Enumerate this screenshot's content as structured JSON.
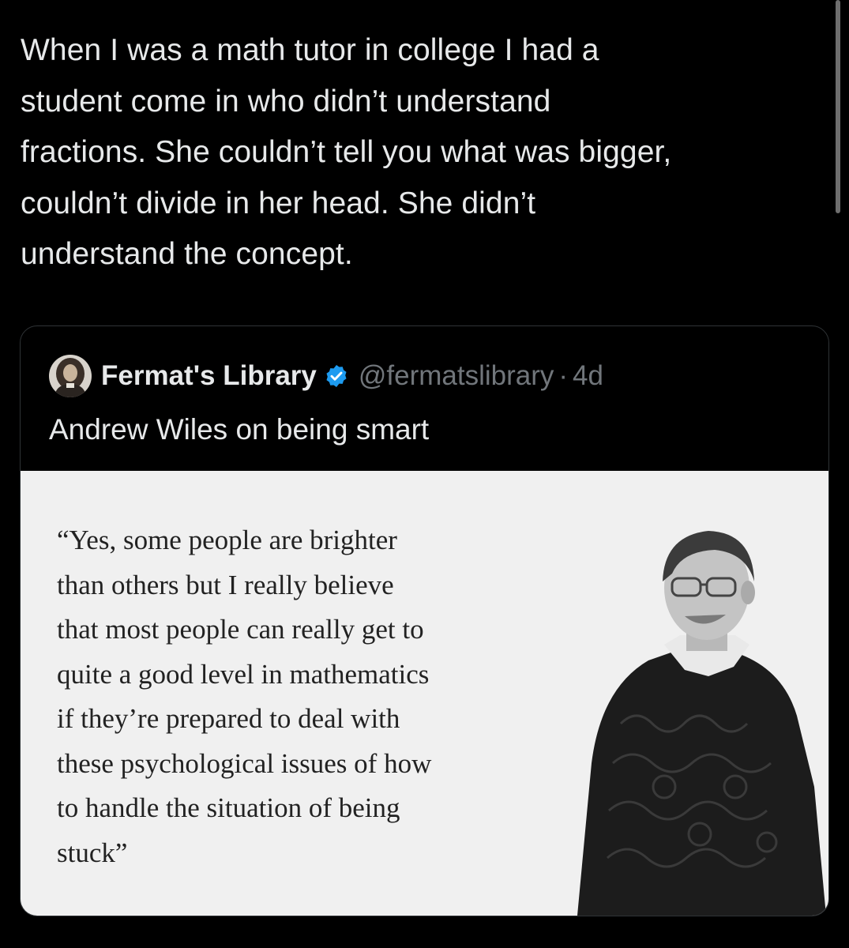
{
  "post": {
    "lines": [
      "When I was a math tutor in college I had a",
      "student come in who didn’t understand",
      "fractions. She couldn’t tell you what was bigger,",
      "couldn’t divide in her head. She didn’t",
      "understand the concept."
    ]
  },
  "quoted_post": {
    "display_name": "Fermat's Library",
    "handle": "@fermatslibrary",
    "separator": "·",
    "time": "4d",
    "text": "Andrew Wiles on being smart",
    "verified_icon": "verified-badge-icon",
    "verified_color": "#1d9bf0",
    "media": {
      "quote_lines": [
        "“Yes, some people are brighter",
        "than others but I really believe",
        "that most people can really get to",
        "quite a good level in mathematics",
        "if they’re prepared to deal with",
        "these psychological issues of how",
        "to handle the situation of being",
        "stuck”"
      ]
    }
  },
  "colors": {
    "background": "#000000",
    "text": "#e7e9ea",
    "secondary_text": "#71767b",
    "card_border": "#2f3336",
    "media_background": "#f0f0f0"
  }
}
